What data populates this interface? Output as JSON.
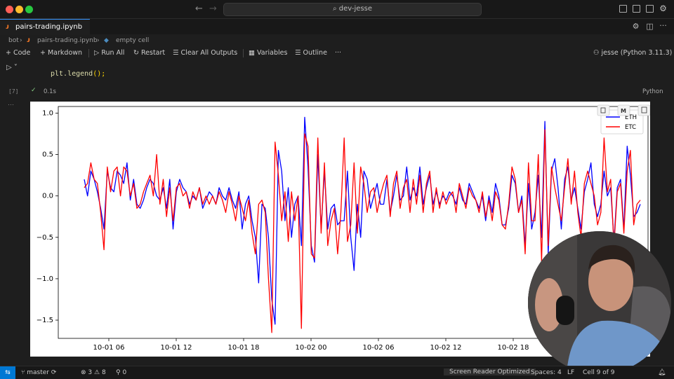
{
  "window": {
    "search_text": "dev-jesse"
  },
  "tab": {
    "label": "pairs-trading.ipynb"
  },
  "breadcrumb": {
    "items": [
      "bot",
      "pairs-trading.ipynb",
      "empty cell"
    ]
  },
  "toolbar": {
    "code": "Code",
    "markdown": "Markdown",
    "run_all": "Run All",
    "restart": "Restart",
    "clear_outputs": "Clear All Outputs",
    "variables": "Variables",
    "outline": "Outline",
    "more": "···",
    "kernel": "jesse (Python 3.11.3)"
  },
  "cell": {
    "code_fn": "plt.legend",
    "code_rest": "();",
    "exec_count": "[7]",
    "exec_time": "0.1s",
    "language": "Python"
  },
  "status": {
    "branch": "master",
    "errors": "3",
    "warnings": "8",
    "ports": "0",
    "screen_reader": "Screen Reader Optimized",
    "spaces": "Spaces: 4",
    "eol": "LF",
    "cell_info": "Cell 9 of 9"
  },
  "chart_data": {
    "type": "line",
    "x_ticks": [
      "10-01 06",
      "10-01 12",
      "10-01 18",
      "10-02 00",
      "10-02 06",
      "10-02 12",
      "10-02 18"
    ],
    "y_ticks": [
      "1.0",
      "0.5",
      "0.0",
      "−0.5",
      "−1.0",
      "−1.5"
    ],
    "ylim": [
      -1.72,
      1.08
    ],
    "xlim": [
      0,
      169
    ],
    "legend_position": "upper right",
    "series": [
      {
        "name": "ETH",
        "color": "#0000ff",
        "values": [
          0.2,
          0.0,
          0.3,
          0.2,
          0.05,
          -0.15,
          -0.4,
          0.3,
          0.1,
          0.05,
          0.3,
          0.25,
          0.15,
          0.4,
          -0.05,
          0.2,
          -0.1,
          -0.15,
          -0.05,
          0.1,
          0.2,
          0.15,
          0.0,
          -0.05,
          0.1,
          -0.15,
          0.2,
          -0.4,
          0.05,
          0.2,
          0.1,
          0.05,
          -0.1,
          0.0,
          -0.05,
          0.1,
          -0.15,
          -0.05,
          0.05,
          0.0,
          -0.1,
          0.1,
          0.0,
          -0.05,
          0.1,
          -0.05,
          -0.15,
          0.05,
          -0.4,
          -0.1,
          0.0,
          -0.3,
          -0.5,
          -1.05,
          -0.1,
          -0.15,
          -0.5,
          -1.25,
          -1.55,
          0.55,
          0.3,
          -0.3,
          0.1,
          -0.5,
          -0.1,
          0.0,
          -0.6,
          0.95,
          0.35,
          -0.6,
          -0.8,
          0.5,
          -0.4,
          0.3,
          -0.4,
          -0.15,
          -0.1,
          -0.35,
          -0.3,
          -0.3,
          0.3,
          -0.5,
          -0.9,
          -0.1,
          -0.5,
          0.3,
          0.2,
          -0.15,
          0.0,
          0.15,
          -0.1,
          -0.1,
          0.2,
          -0.2,
          0.0,
          0.25,
          -0.05,
          0.0,
          0.35,
          -0.05,
          0.1,
          0.0,
          0.35,
          -0.1,
          0.1,
          0.25,
          -0.1,
          0.05,
          -0.1,
          0.0,
          -0.05,
          0.05,
          0.0,
          -0.1,
          0.1,
          -0.05,
          -0.1,
          0.15,
          0.05,
          -0.05,
          -0.15,
          0.0,
          -0.3,
          0.0,
          -0.2,
          0.15,
          0.0,
          -0.35,
          -0.35,
          -0.15,
          0.25,
          0.15,
          -0.2,
          0.0,
          -0.6,
          0.15,
          -0.4,
          -0.2,
          0.25,
          -0.5,
          0.9,
          -0.7,
          0.3,
          0.45,
          0.1,
          -0.4,
          0.2,
          0.35,
          -0.05,
          0.1,
          -0.15,
          -0.4,
          0.05,
          0.2,
          0.4,
          -0.1,
          -0.25,
          -0.1,
          0.3,
          0.0,
          0.1,
          -0.55,
          0.1,
          0.2,
          -0.4,
          0.6,
          0.25,
          -0.25,
          -0.2,
          -0.1
        ]
      },
      {
        "name": "ETC",
        "color": "#ff0000",
        "values": [
          0.1,
          0.15,
          0.4,
          0.2,
          0.15,
          -0.2,
          -0.65,
          0.35,
          0.05,
          0.3,
          0.35,
          0.0,
          0.35,
          0.3,
          0.0,
          0.15,
          -0.15,
          -0.1,
          0.05,
          0.15,
          0.25,
          0.0,
          0.5,
          -0.1,
          0.2,
          -0.25,
          0.1,
          -0.3,
          0.1,
          0.15,
          0.0,
          0.05,
          -0.15,
          0.05,
          -0.05,
          0.1,
          -0.1,
          0.0,
          -0.1,
          0.0,
          -0.1,
          0.05,
          -0.05,
          -0.2,
          0.05,
          -0.1,
          -0.3,
          0.0,
          -0.15,
          -0.3,
          -0.05,
          -0.45,
          -0.7,
          -0.1,
          -0.05,
          -0.2,
          -1.0,
          -1.65,
          0.65,
          0.25,
          -0.3,
          0.05,
          -0.55,
          0.05,
          -0.3,
          0.0,
          -1.6,
          0.75,
          0.6,
          -0.7,
          -0.75,
          0.7,
          -0.45,
          0.4,
          -0.6,
          -0.3,
          -0.15,
          -0.7,
          -0.2,
          0.7,
          -0.55,
          -0.35,
          0.4,
          -0.45,
          0.35,
          0.15,
          -0.2,
          0.05,
          0.1,
          -0.2,
          0.0,
          0.15,
          0.25,
          -0.25,
          0.15,
          0.3,
          -0.15,
          0.1,
          0.2,
          -0.2,
          0.2,
          -0.1,
          0.25,
          -0.2,
          0.15,
          0.3,
          -0.2,
          0.1,
          -0.15,
          0.05,
          -0.1,
          0.0,
          0.05,
          -0.2,
          0.15,
          0.0,
          -0.15,
          0.1,
          0.0,
          -0.05,
          -0.2,
          0.05,
          -0.25,
          -0.05,
          -0.3,
          0.05,
          -0.05,
          -0.35,
          -0.4,
          -0.1,
          0.35,
          0.2,
          -0.2,
          -0.05,
          -0.7,
          0.4,
          -0.3,
          -0.3,
          0.5,
          -0.8,
          0.8,
          -0.6,
          0.35,
          0.1,
          -0.1,
          -0.3,
          0.1,
          0.45,
          -0.1,
          0.3,
          -0.2,
          -0.5,
          0.15,
          0.3,
          0.15,
          0.0,
          -0.35,
          -0.2,
          0.7,
          0.05,
          0.2,
          -0.6,
          0.05,
          0.15,
          -0.45,
          0.3,
          0.55,
          -0.35,
          -0.1,
          -0.05
        ]
      }
    ]
  }
}
